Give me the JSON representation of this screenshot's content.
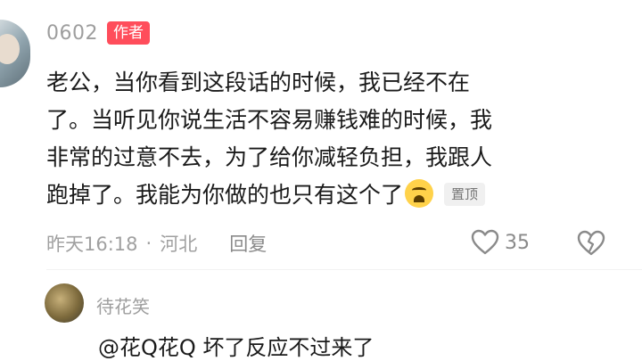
{
  "comment": {
    "author": "0602",
    "author_badge": "作者",
    "lines": [
      "老公，当你看到这段话的时候，我已经不在",
      "了。当听见你说生活不容易赚钱难的时候，我",
      "非常的过意不去，为了给你减轻负担，我跟人",
      "跑掉了。我能为你做的也只有这个了"
    ],
    "emoji": "crying-face-icon",
    "pinned_label": "置顶",
    "time": "昨天16:18",
    "separator": "·",
    "location": "河北",
    "reply_label": "回复",
    "like_count": "35"
  },
  "reply": {
    "author": "待花笑",
    "mention": "@花Q花Q",
    "text": "坏了反应不过来了"
  },
  "colors": {
    "badge_red": "#ff4d5b",
    "text_primary": "#1a1a1a",
    "text_secondary": "#9e9e9e"
  }
}
